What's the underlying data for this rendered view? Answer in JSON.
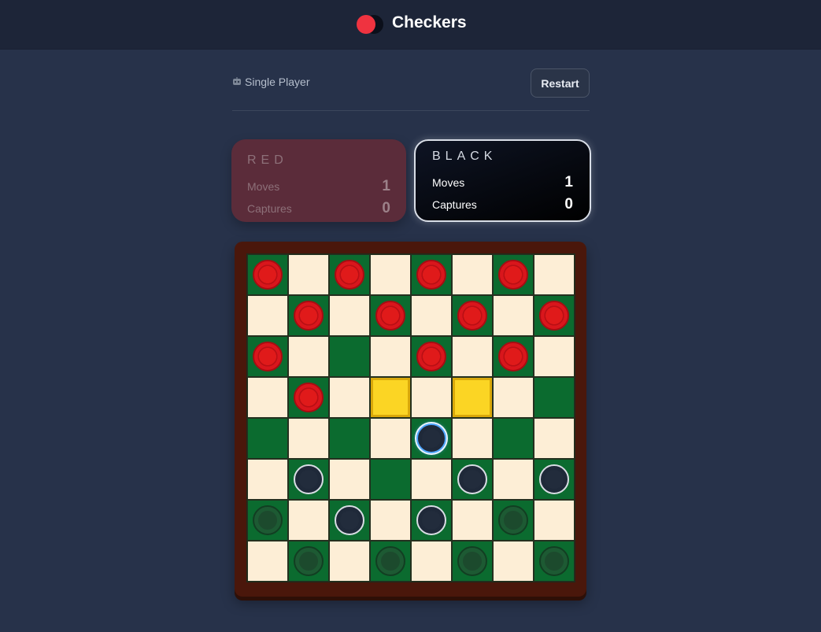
{
  "header": {
    "title": "Checkers",
    "logo_colors": {
      "red": "#ef3340",
      "black": "#0b0f1a"
    }
  },
  "toolbar": {
    "mode_icon": "robot-icon",
    "mode_label": "Single Player",
    "restart_label": "Restart"
  },
  "players": {
    "red": {
      "name": "RED",
      "moves_label": "Moves",
      "moves": "1",
      "captures_label": "Captures",
      "captures": "0",
      "active": false
    },
    "black": {
      "name": "BLACK",
      "moves_label": "Moves",
      "moves": "1",
      "captures_label": "Captures",
      "captures": "0",
      "active": true
    }
  },
  "board": {
    "size": 8,
    "colors": {
      "light": "#fdeed6",
      "dark": "#0b6b2f",
      "hint": "#fbd524",
      "frame": "#4a170b"
    },
    "rows": [
      [
        "r",
        "",
        "r",
        "",
        "r",
        "",
        "r",
        ""
      ],
      [
        "",
        "r",
        "",
        "r",
        "",
        "r",
        "",
        "r"
      ],
      [
        "r",
        "",
        "",
        "",
        "r",
        "",
        "r",
        ""
      ],
      [
        "",
        "r",
        "",
        "hint",
        "",
        "hint",
        "",
        ""
      ],
      [
        "",
        "",
        "",
        "",
        "b*",
        "",
        "",
        ""
      ],
      [
        "",
        "b",
        "",
        "",
        "",
        "b",
        "",
        "b"
      ],
      [
        "g",
        "",
        "b",
        "",
        "b",
        "",
        "g",
        ""
      ],
      [
        "",
        "g",
        "",
        "g",
        "",
        "g",
        "",
        "g"
      ]
    ],
    "legend": {
      "r": "red piece",
      "b": "black piece",
      "b*": "selected black piece",
      "g": "empty-slot marker",
      "hint": "valid move highlight"
    }
  }
}
